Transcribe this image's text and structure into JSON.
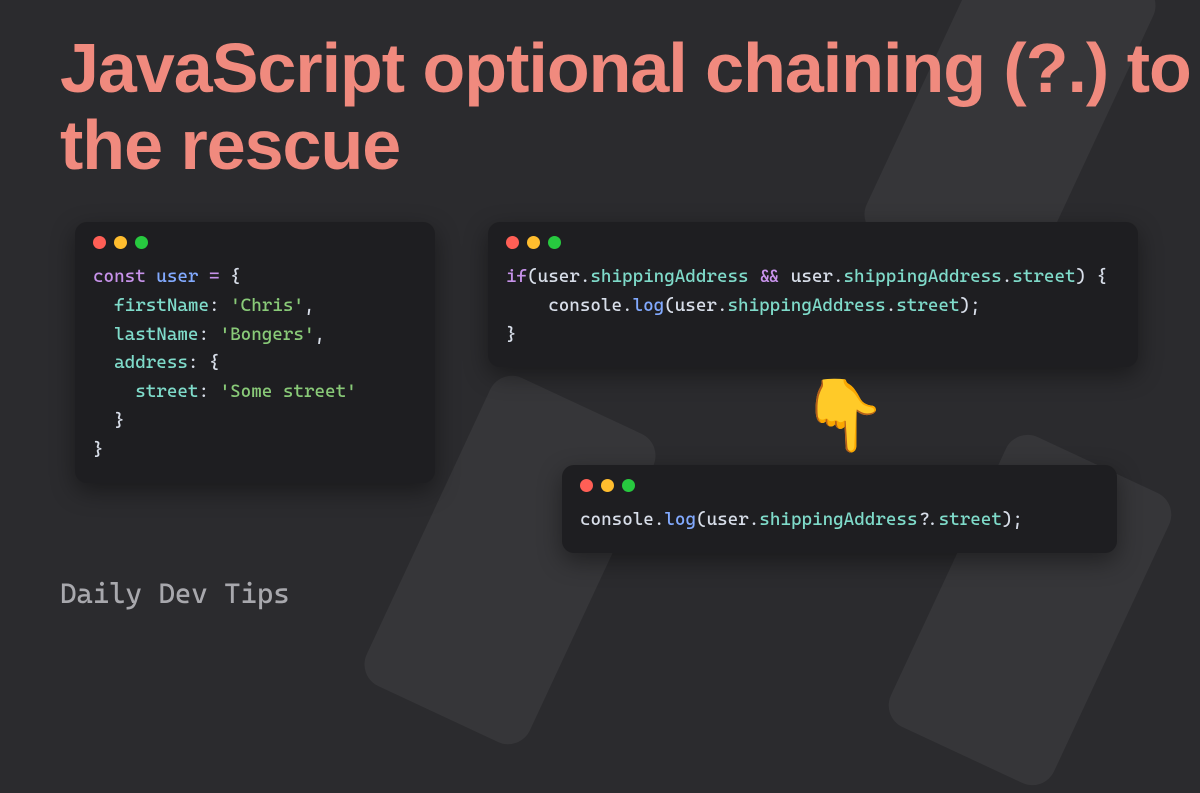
{
  "title": "JavaScript optional chaining (?.) to the rescue",
  "footer": "Daily Dev Tips",
  "pointer_emoji": "👇",
  "code": {
    "window1": {
      "l1_kw": "const",
      "l1_var": " user ",
      "l1_op": "=",
      "l1_punc": " {",
      "l2_prop": "  firstName",
      "l2_punc1": ": ",
      "l2_str": "'Chris'",
      "l2_punc2": ",",
      "l3_prop": "  lastName",
      "l3_punc1": ": ",
      "l3_str": "'Bongers'",
      "l3_punc2": ",",
      "l4_prop": "  address",
      "l4_punc": ": {",
      "l5_prop": "    street",
      "l5_punc1": ": ",
      "l5_str": "'Some street'",
      "l6": "  }",
      "l7": "}"
    },
    "window2": {
      "l1a": "if",
      "l1b": "(",
      "l1c": "user",
      "l1d": ".",
      "l1e": "shippingAddress",
      "l1f": " && ",
      "l1g": "user",
      "l1h": ".",
      "l1i": "shippingAddress",
      "l1j": ".",
      "l1k": "street",
      "l1l": ") {",
      "l2a": "    console",
      "l2b": ".",
      "l2c": "log",
      "l2d": "(",
      "l2e": "user",
      "l2f": ".",
      "l2g": "shippingAddress",
      "l2h": ".",
      "l2i": "street",
      "l2j": ");",
      "l3": "}"
    },
    "window3": {
      "l1a": "console",
      "l1b": ".",
      "l1c": "log",
      "l1d": "(",
      "l1e": "user",
      "l1f": ".",
      "l1g": "shippingAddress",
      "l1h": "?.",
      "l1i": "street",
      "l1j": ");"
    }
  }
}
